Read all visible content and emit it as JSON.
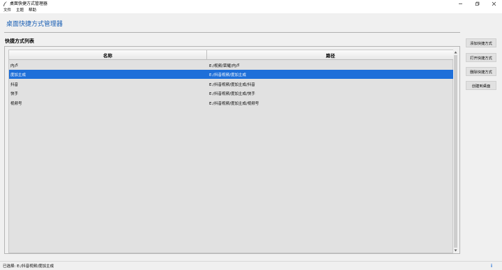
{
  "window": {
    "title": "桌面快捷方式管理器",
    "icon": "feather-icon",
    "controls": [
      "minimize-icon",
      "maximize-icon",
      "close-icon"
    ]
  },
  "menu": [
    "文件",
    "主题",
    "帮助"
  ],
  "header": {
    "title": "桌面快捷方式管理器"
  },
  "section": {
    "title": "快捷方式列表"
  },
  "table": {
    "columns": [
      "名称",
      "路径"
    ],
    "rows": [
      {
        "name": "内卢",
        "path": "E:/视频/荣耀/内卢"
      },
      {
        "name": "度加主成",
        "path": "E:/抖音视频/度加主成"
      },
      {
        "name": "抖音",
        "path": "E:/抖音视频/度加主成/抖音"
      },
      {
        "name": "快手",
        "path": "E:/抖音视频/度加主成/快手"
      },
      {
        "name": "视频号",
        "path": "E:/抖音视频/度加主成/视频号"
      }
    ],
    "selected_index": 1,
    "selection_color": "#1e6fd9"
  },
  "buttons": {
    "add": "添加快捷方式",
    "open": "打开快捷方式",
    "delete": "删除快捷方式",
    "desktop": "创建到桌面"
  },
  "status": {
    "text": "已选择: E:/抖音视频/度加主成",
    "icon": "info-icon"
  },
  "colors": {
    "accent": "#1a5fb4",
    "background": "#f0f0f0"
  }
}
